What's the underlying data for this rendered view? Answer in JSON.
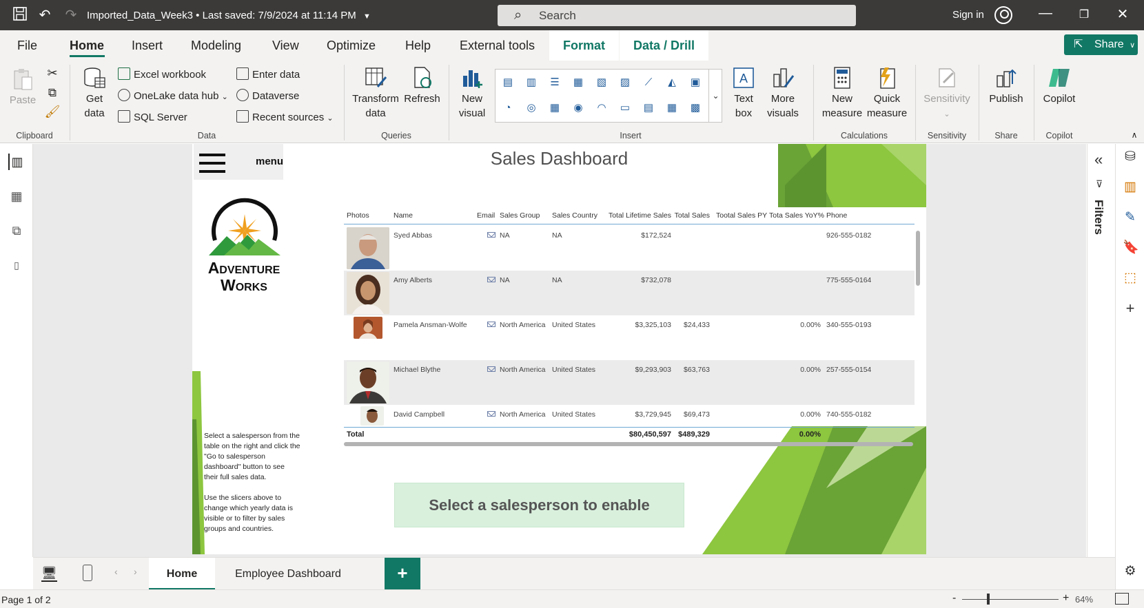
{
  "titlebar": {
    "file_title": "Imported_Data_Week3",
    "saved_status": "Last saved: 7/9/2024 at 11:14 PM",
    "search_placeholder": "Search",
    "sign_in": "Sign in"
  },
  "menu": {
    "items": [
      "File",
      "Home",
      "Insert",
      "Modeling",
      "View",
      "Optimize",
      "Help",
      "External tools"
    ],
    "context_tabs": [
      "Format",
      "Data / Drill"
    ],
    "share_label": "Share"
  },
  "ribbon": {
    "clipboard": {
      "paste": "Paste",
      "group": "Clipboard"
    },
    "data": {
      "get_data": "Get data",
      "excel": "Excel workbook",
      "onelake": "OneLake data hub",
      "sql": "SQL Server",
      "enter_data": "Enter data",
      "dataverse": "Dataverse",
      "recent": "Recent sources",
      "group": "Data"
    },
    "queries": {
      "transform": "Transform data",
      "refresh": "Refresh",
      "group": "Queries"
    },
    "insert": {
      "new_visual": "New visual",
      "text_box": "Text box",
      "more_visuals": "More visuals",
      "group": "Insert"
    },
    "calculations": {
      "new_measure": "New measure",
      "quick_measure": "Quick measure",
      "group": "Calculations"
    },
    "sensitivity": {
      "label": "Sensitivity",
      "group": "Sensitivity"
    },
    "share": {
      "publish": "Publish",
      "group": "Share"
    },
    "copilot": {
      "label": "Copilot",
      "group": "Copilot"
    }
  },
  "report": {
    "menu_label": "menu",
    "title": "Sales Dashboard",
    "logo_line1": "Adventure",
    "logo_line2": "Works",
    "help_p1": "Select a salesperson from the table on the right and click the \"Go to salesperson dashboard\" button to see their full sales data.",
    "help_p2": "Use the slicers above to change which yearly data is visible or to filter by sales groups and countries.",
    "button_label": "Select a salesperson to enable",
    "table": {
      "headers": [
        "Photos",
        "Name",
        "Email",
        "Sales Group",
        "Sales Country",
        "Total Lifetime Sales",
        "Total Sales",
        "Tootal Sales PY",
        "Tota Sales YoY%",
        "Phone"
      ],
      "rows": [
        {
          "name": "Syed Abbas",
          "group": "NA",
          "country": "NA",
          "lifetime": "$172,524",
          "sales": "",
          "py": "",
          "yoy": "",
          "phone": "926-555-0182"
        },
        {
          "name": "Amy Alberts",
          "group": "NA",
          "country": "NA",
          "lifetime": "$732,078",
          "sales": "",
          "py": "",
          "yoy": "",
          "phone": "775-555-0164"
        },
        {
          "name": "Pamela Ansman-Wolfe",
          "group": "North America",
          "country": "United States",
          "lifetime": "$3,325,103",
          "sales": "$24,433",
          "py": "",
          "yoy": "0.00%",
          "phone": "340-555-0193"
        },
        {
          "name": "Michael Blythe",
          "group": "North America",
          "country": "United States",
          "lifetime": "$9,293,903",
          "sales": "$63,763",
          "py": "",
          "yoy": "0.00%",
          "phone": "257-555-0154"
        },
        {
          "name": "David Campbell",
          "group": "North America",
          "country": "United States",
          "lifetime": "$3,729,945",
          "sales": "$69,473",
          "py": "",
          "yoy": "0.00%",
          "phone": "740-555-0182"
        }
      ],
      "total": {
        "label": "Total",
        "lifetime": "$80,450,597",
        "sales": "$489,329",
        "yoy": "0.00%"
      }
    }
  },
  "filters_label": "Filters",
  "tabs": {
    "home": "Home",
    "employee": "Employee Dashboard",
    "add": "+"
  },
  "status": {
    "page": "Page 1 of 2",
    "zoom": "64%"
  },
  "colors": {
    "accent": "#117865",
    "title_bar": "#3b3a39",
    "green_light": "#8dc63f",
    "green_dark": "#5aa02c"
  }
}
